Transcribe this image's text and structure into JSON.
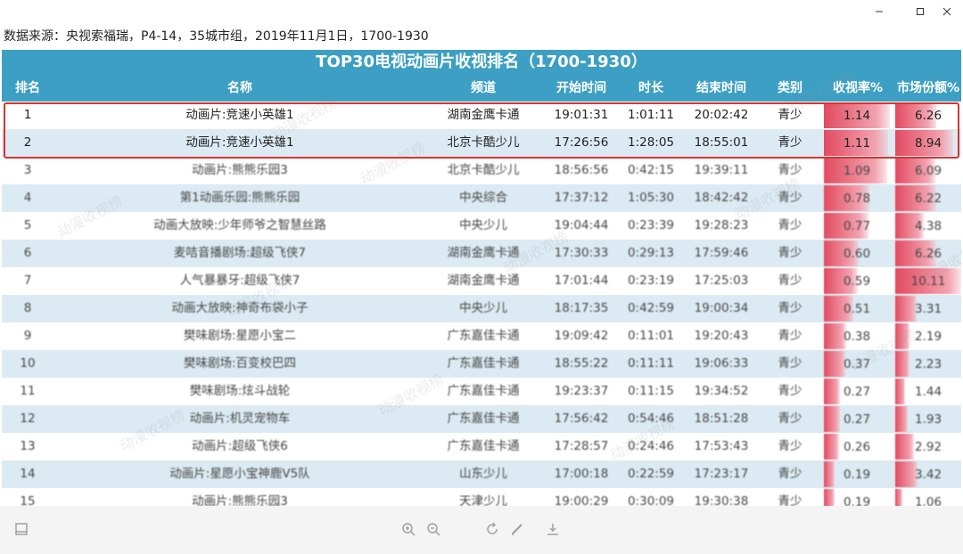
{
  "source_line": "数据来源：央视索福瑞，P4-14，35城市组，2019年11月1日，1700-1930",
  "table": {
    "title": "TOP30电视动画片收视排名（1700-1930）",
    "headers": {
      "rank": "排名",
      "name": "名称",
      "channel": "频道",
      "start": "开始时间",
      "duration": "时长",
      "end": "结束时间",
      "category": "类别",
      "rating": "收视率%",
      "share": "市场份额%"
    },
    "rows": [
      {
        "rank": "1",
        "name": "动画片:竞速小英雄1",
        "channel": "湖南金鹰卡通",
        "start": "19:01:31",
        "duration": "1:01:11",
        "end": "20:02:42",
        "category": "青少",
        "rating": "1.14",
        "share": "6.26"
      },
      {
        "rank": "2",
        "name": "动画片:竞速小英雄1",
        "channel": "北京卡酷少儿",
        "start": "17:26:56",
        "duration": "1:28:05",
        "end": "18:55:01",
        "category": "青少",
        "rating": "1.11",
        "share": "8.94"
      },
      {
        "rank": "3",
        "name": "动画片:熊熊乐园3",
        "channel": "北京卡酷少儿",
        "start": "18:56:56",
        "duration": "0:42:15",
        "end": "19:39:11",
        "category": "青少",
        "rating": "1.09",
        "share": "6.09"
      },
      {
        "rank": "4",
        "name": "第1动画乐园:熊熊乐园",
        "channel": "中央综合",
        "start": "17:37:12",
        "duration": "1:05:30",
        "end": "18:42:42",
        "category": "青少",
        "rating": "0.78",
        "share": "6.22"
      },
      {
        "rank": "5",
        "name": "动画大放映:少年师爷之智慧丝路",
        "channel": "中央少儿",
        "start": "19:04:44",
        "duration": "0:23:39",
        "end": "19:28:23",
        "category": "青少",
        "rating": "0.77",
        "share": "4.38"
      },
      {
        "rank": "6",
        "name": "麦咭音播剧场:超级飞侠7",
        "channel": "湖南金鹰卡通",
        "start": "17:30:33",
        "duration": "0:29:13",
        "end": "17:59:46",
        "category": "青少",
        "rating": "0.60",
        "share": "6.26"
      },
      {
        "rank": "7",
        "name": "人气暴暴牙:超级飞侠7",
        "channel": "湖南金鹰卡通",
        "start": "17:01:44",
        "duration": "0:23:19",
        "end": "17:25:03",
        "category": "青少",
        "rating": "0.59",
        "share": "10.11"
      },
      {
        "rank": "8",
        "name": "动画大放映:神奇布袋小子",
        "channel": "中央少儿",
        "start": "18:17:35",
        "duration": "0:42:59",
        "end": "19:00:34",
        "category": "青少",
        "rating": "0.51",
        "share": "3.31"
      },
      {
        "rank": "9",
        "name": "樊味剧场:星愿小宝二",
        "channel": "广东嘉佳卡通",
        "start": "19:09:42",
        "duration": "0:11:01",
        "end": "19:20:43",
        "category": "青少",
        "rating": "0.38",
        "share": "2.19"
      },
      {
        "rank": "10",
        "name": "樊味剧场:百变校巴四",
        "channel": "广东嘉佳卡通",
        "start": "18:55:22",
        "duration": "0:11:11",
        "end": "19:06:33",
        "category": "青少",
        "rating": "0.37",
        "share": "2.23"
      },
      {
        "rank": "11",
        "name": "樊味剧场:炫斗战轮",
        "channel": "广东嘉佳卡通",
        "start": "19:23:37",
        "duration": "0:11:15",
        "end": "19:34:52",
        "category": "青少",
        "rating": "0.27",
        "share": "1.44"
      },
      {
        "rank": "12",
        "name": "动画片:机灵宠物车",
        "channel": "广东嘉佳卡通",
        "start": "17:56:42",
        "duration": "0:54:46",
        "end": "18:51:28",
        "category": "青少",
        "rating": "0.27",
        "share": "1.93"
      },
      {
        "rank": "13",
        "name": "动画片:超级飞侠6",
        "channel": "广东嘉佳卡通",
        "start": "17:28:57",
        "duration": "0:24:46",
        "end": "17:53:43",
        "category": "青少",
        "rating": "0.26",
        "share": "2.92"
      },
      {
        "rank": "14",
        "name": "动画片:星愿小宝神鹿V5队",
        "channel": "山东少儿",
        "start": "17:00:18",
        "duration": "0:22:59",
        "end": "17:23:17",
        "category": "青少",
        "rating": "0.19",
        "share": "3.42"
      },
      {
        "rank": "15",
        "name": "动画片:熊熊乐园3",
        "channel": "天津少儿",
        "start": "19:00:29",
        "duration": "0:30:09",
        "end": "19:30:38",
        "category": "青少",
        "rating": "0.19",
        "share": "1.06"
      }
    ]
  },
  "watermark_text": "动漫收视榜",
  "colors": {
    "header_bg": "#3d9fc4",
    "row_alt": "#dcebf3",
    "bar": "#e24a60",
    "highlight": "#d8342f"
  }
}
